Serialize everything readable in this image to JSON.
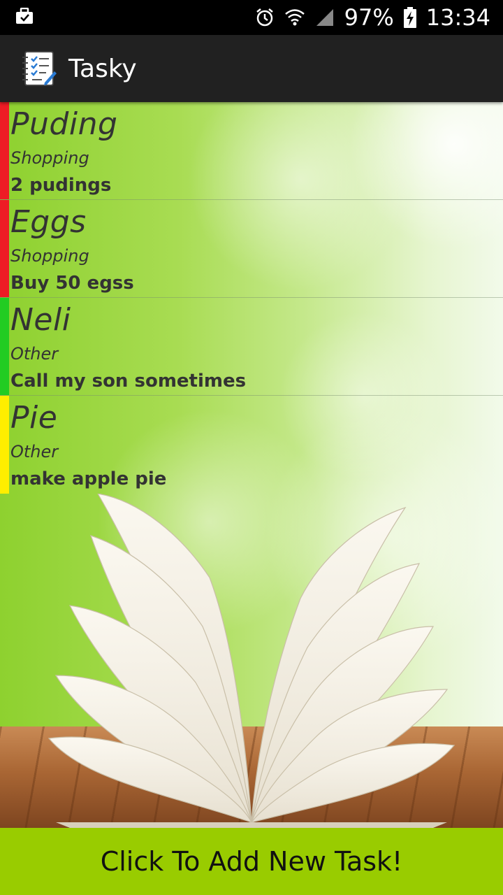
{
  "status_bar": {
    "battery": "97%",
    "time": "13:34",
    "icons": [
      "briefcase-icon",
      "alarm-icon",
      "wifi-icon",
      "signal-icon",
      "battery-charging-icon"
    ]
  },
  "app_bar": {
    "title": "Tasky",
    "icon": "checklist-notebook-icon"
  },
  "tasks": [
    {
      "title": "Puding",
      "category": "Shopping",
      "description": "2 pudings",
      "priority_color": "#ee1c25"
    },
    {
      "title": "Eggs",
      "category": "Shopping",
      "description": "Buy 50 egss",
      "priority_color": "#ee1c25"
    },
    {
      "title": "Neli",
      "category": "Other",
      "description": "Call my son sometimes",
      "priority_color": "#22cc22"
    },
    {
      "title": "Pie",
      "category": "Other",
      "description": "make apple pie",
      "priority_color": "#ffee00"
    }
  ],
  "add_button": {
    "label": "Click To Add New Task!",
    "color": "#99cc00"
  },
  "background": "open-book-on-wooden-table-with-green-bokeh"
}
